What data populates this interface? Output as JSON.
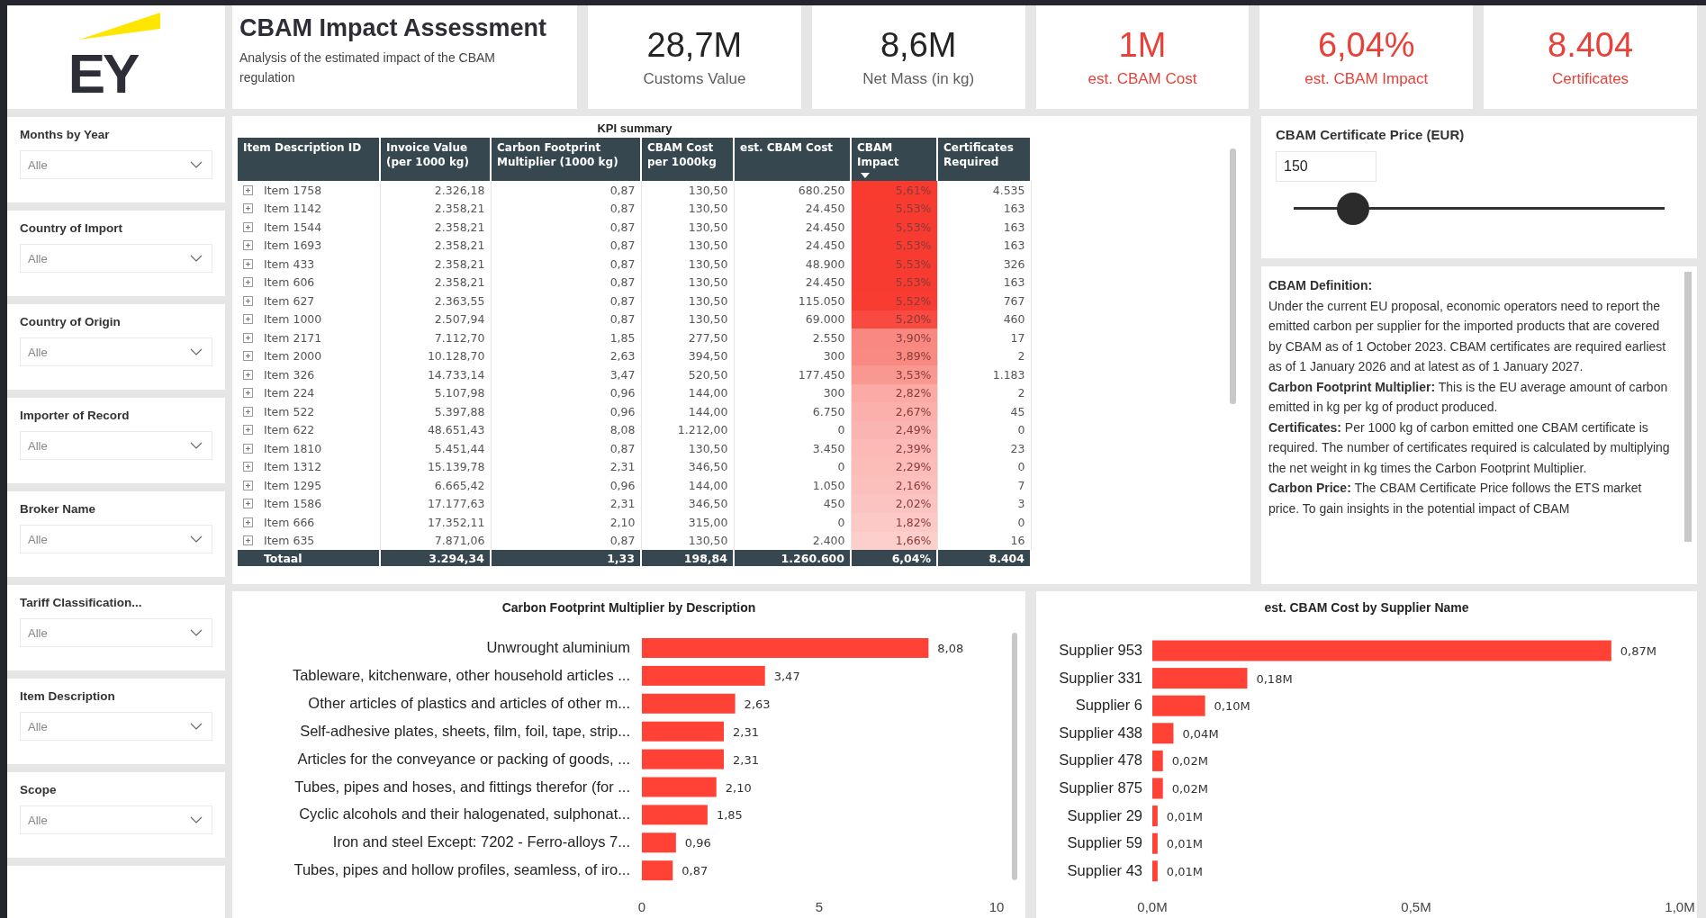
{
  "logo": {
    "text": "EY"
  },
  "header": {
    "title": "CBAM Impact Assessment",
    "subtitle": "Analysis of the estimated impact of the CBAM regulation"
  },
  "kpis": [
    {
      "value": "28,7M",
      "label": "Customs Value",
      "highlight": false
    },
    {
      "value": "8,6M",
      "label": "Net Mass (in kg)",
      "highlight": false
    },
    {
      "value": "1M",
      "label": "est. CBAM Cost",
      "highlight": true
    },
    {
      "value": "6,04%",
      "label": "est. CBAM Impact",
      "highlight": true
    },
    {
      "value": "8.404",
      "label": "Certificates",
      "highlight": true
    }
  ],
  "slicers": [
    {
      "title": "Months by Year",
      "value": "Alle"
    },
    {
      "title": "Country of Import",
      "value": "Alle"
    },
    {
      "title": "Country of Origin",
      "value": "Alle"
    },
    {
      "title": "Importer of Record",
      "value": "Alle"
    },
    {
      "title": "Broker Name",
      "value": "Alle"
    },
    {
      "title": "Tariff Classification...",
      "value": "Alle"
    },
    {
      "title": "Item Description",
      "value": "Alle"
    },
    {
      "title": "Scope",
      "value": "Alle"
    }
  ],
  "table": {
    "title": "KPI summary",
    "columns": [
      {
        "label": "Item Description ID",
        "sorted": false
      },
      {
        "label": "Invoice Value\n(per 1000 kg)",
        "sorted": false
      },
      {
        "label": "Carbon Footprint\nMultiplier (1000 kg)",
        "sorted": false
      },
      {
        "label": "CBAM Cost\nper 1000kg",
        "sorted": false
      },
      {
        "label": "est. CBAM Cost",
        "sorted": false
      },
      {
        "label": "CBAM\nImpact",
        "sorted": true
      },
      {
        "label": "Certificates\nRequired",
        "sorted": false
      }
    ],
    "rows": [
      {
        "cells": [
          "Item 1758",
          "2.326,18",
          "0,87",
          "130,50",
          "680.250",
          "5,61%",
          "4.535"
        ],
        "color": "#f83a2f"
      },
      {
        "cells": [
          "Item 1142",
          "2.358,21",
          "0,87",
          "130,50",
          "24.450",
          "5,53%",
          "163"
        ],
        "color": "#f83b30"
      },
      {
        "cells": [
          "Item 1544",
          "2.358,21",
          "0,87",
          "130,50",
          "24.450",
          "5,53%",
          "163"
        ],
        "color": "#f83b30"
      },
      {
        "cells": [
          "Item 1693",
          "2.358,21",
          "0,87",
          "130,50",
          "24.450",
          "5,53%",
          "163"
        ],
        "color": "#f83b30"
      },
      {
        "cells": [
          "Item 433",
          "2.358,21",
          "0,87",
          "130,50",
          "48.900",
          "5,53%",
          "326"
        ],
        "color": "#f83b30"
      },
      {
        "cells": [
          "Item 606",
          "2.358,21",
          "0,87",
          "130,50",
          "24.450",
          "5,53%",
          "163"
        ],
        "color": "#f83b30"
      },
      {
        "cells": [
          "Item 627",
          "2.363,55",
          "0,87",
          "130,50",
          "115.050",
          "5,52%",
          "767"
        ],
        "color": "#f83c31"
      },
      {
        "cells": [
          "Item 1000",
          "2.507,94",
          "0,87",
          "130,50",
          "69.000",
          "5,20%",
          "460"
        ],
        "color": "#f84a40"
      },
      {
        "cells": [
          "Item 2171",
          "7.112,70",
          "1,85",
          "277,50",
          "2.550",
          "3,90%",
          "17"
        ],
        "color": "#f98880"
      },
      {
        "cells": [
          "Item 2000",
          "10.128,70",
          "2,63",
          "394,50",
          "300",
          "3,89%",
          "2"
        ],
        "color": "#f98a82"
      },
      {
        "cells": [
          "Item 326",
          "14.733,14",
          "3,47",
          "520,50",
          "177.450",
          "3,53%",
          "1.183"
        ],
        "color": "#f99891"
      },
      {
        "cells": [
          "Item 224",
          "5.107,98",
          "0,96",
          "144,00",
          "300",
          "2,82%",
          "2"
        ],
        "color": "#fbaaa5"
      },
      {
        "cells": [
          "Item 522",
          "5.397,88",
          "0,96",
          "144,00",
          "6.750",
          "2,67%",
          "45"
        ],
        "color": "#fbb0ab"
      },
      {
        "cells": [
          "Item 622",
          "48.651,43",
          "8,08",
          "1.212,00",
          "0",
          "2,49%",
          "0"
        ],
        "color": "#fbb5b1"
      },
      {
        "cells": [
          "Item 1810",
          "5.451,44",
          "0,87",
          "130,50",
          "3.450",
          "2,39%",
          "23"
        ],
        "color": "#fcb9b5"
      },
      {
        "cells": [
          "Item 1312",
          "15.139,78",
          "2,31",
          "346,50",
          "0",
          "2,29%",
          "0"
        ],
        "color": "#fcbcb8"
      },
      {
        "cells": [
          "Item 1295",
          "6.665,42",
          "0,96",
          "144,00",
          "1.050",
          "2,16%",
          "7"
        ],
        "color": "#fcc0bc"
      },
      {
        "cells": [
          "Item 1586",
          "17.177,63",
          "2,31",
          "346,50",
          "450",
          "2,02%",
          "3"
        ],
        "color": "#fcc4c1"
      },
      {
        "cells": [
          "Item 666",
          "17.352,11",
          "2,10",
          "315,00",
          "0",
          "1,82%",
          "0"
        ],
        "color": "#fdc9c6"
      },
      {
        "cells": [
          "Item 635",
          "7.871,06",
          "0,87",
          "130,50",
          "2.400",
          "1,66%",
          "16"
        ],
        "color": "#fdcfcc"
      }
    ],
    "total": [
      "Totaal",
      "3.294,34",
      "1,33",
      "198,84",
      "1.260.600",
      "6,04%",
      "8.404"
    ]
  },
  "price": {
    "title": "CBAM Certificate Price (EUR)",
    "value": "150",
    "level": 0.16
  },
  "definition": {
    "title": "CBAM Definition:",
    "paragraphs": [
      "Under the current EU proposal, economic operators need to report the emitted carbon per supplier for the imported products that are covered by CBAM as of 1  October 2023. CBAM certificates are required earliest as of 1 January 2026 and at latest as of 1 January 2027.",
      "**Carbon Footprint Multiplier:** This is the EU average amount of carbon emitted in kg per kg of product produced.",
      "**Certificates:** Per 1000 kg of carbon emitted one CBAM certificate is required. The number of certificates required is calculated by multiplying the net weight in kg times the Carbon Footprint Multiplier.",
      "**Carbon Price:** The CBAM Certificate Price follows the ETS market price. To gain insights in the potential impact of CBAM"
    ]
  },
  "charts": [
    {
      "chart_data": {
        "type": "bar",
        "orientation": "horizontal",
        "title": "Carbon Footprint Multiplier by Description",
        "categories": [
          "Unwrought aluminium",
          "Tableware, kitchenware, other household articles ...",
          "Other articles of plastics and articles of other m...",
          "Self-adhesive plates, sheets, film, foil, tape, strip...",
          "Articles for the conveyance or packing of goods, ...",
          "Tubes, pipes and hoses, and fittings therefor (for ...",
          "Cyclic alcohols and their halogenated, sulphonat...",
          "Iron and steel Except: 7202 - Ferro-alloys 7...",
          "Tubes, pipes and hollow profiles, seamless, of iro..."
        ],
        "values": [
          8.08,
          3.47,
          2.63,
          2.31,
          2.31,
          2.1,
          1.85,
          0.96,
          0.87
        ],
        "value_labels": [
          "8,08",
          "3,47",
          "2,63",
          "2,31",
          "2,31",
          "2,10",
          "1,85",
          "0,96",
          "0,87"
        ],
        "xlim": [
          0,
          10
        ],
        "xticks": [
          0,
          5,
          10
        ]
      }
    },
    {
      "chart_data": {
        "type": "bar",
        "orientation": "horizontal",
        "title": "est. CBAM Cost by Supplier Name",
        "categories": [
          "Supplier 953",
          "Supplier 331",
          "Supplier 6",
          "Supplier 438",
          "Supplier 478",
          "Supplier 875",
          "Supplier 29",
          "Supplier 59",
          "Supplier 43"
        ],
        "values": [
          0.87,
          0.18,
          0.1,
          0.04,
          0.02,
          0.02,
          0.01,
          0.01,
          0.01
        ],
        "value_labels": [
          "0,87M",
          "0,18M",
          "0,10M",
          "0,04M",
          "0,02M",
          "0,02M",
          "0,01M",
          "0,01M",
          "0,01M"
        ],
        "xlim": [
          0,
          1
        ],
        "xticks": [
          {
            "value": 0,
            "label": "0,0M"
          },
          {
            "value": 0.5,
            "label": "0,5M"
          },
          {
            "value": 1,
            "label": "1,0M"
          }
        ]
      }
    }
  ]
}
